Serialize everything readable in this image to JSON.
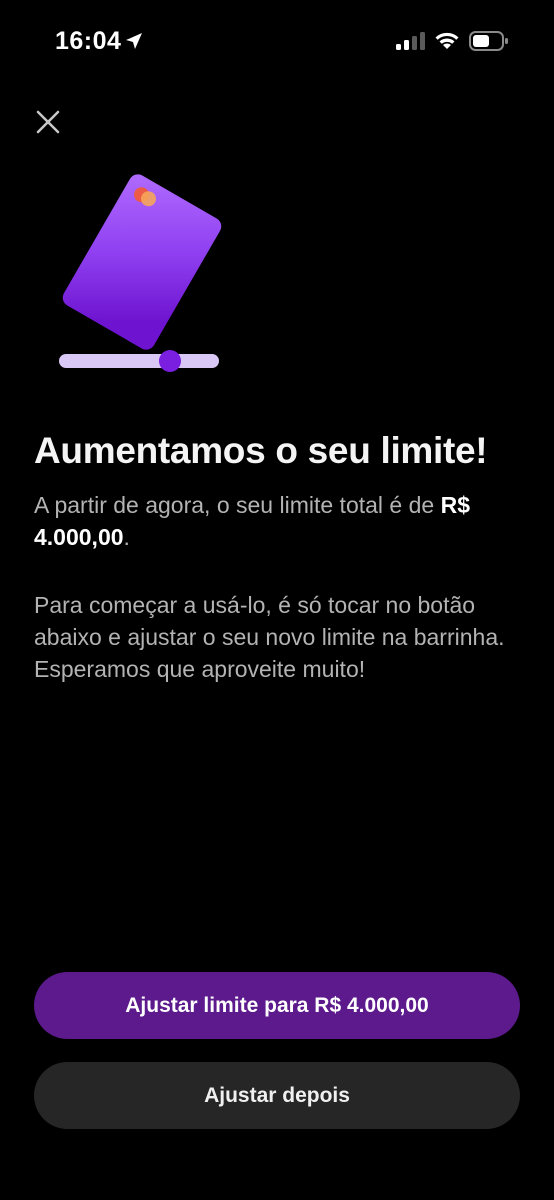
{
  "status_bar": {
    "time": "16:04",
    "icons": [
      "location-arrow-icon",
      "cellular-signal-icon",
      "wifi-icon",
      "battery-icon"
    ]
  },
  "header": {
    "close_icon": "close-icon"
  },
  "illustration": {
    "description_icons": [
      "credit-card-icon",
      "limit-slider-icon"
    ],
    "colors": {
      "card": "#8a2be2",
      "card_light": "#a95bff",
      "slider_track": "#d9c8f5",
      "slider_knob": "#7a1ee0",
      "logo_red": "#f05a3c",
      "logo_orange": "#f6a55a"
    },
    "slider_level": 0.7
  },
  "content": {
    "title": "Aumentamos o seu limite!",
    "paragraph1_prefix": "A partir de agora, o seu limite total é de ",
    "paragraph1_amount": "R$ 4.000,00",
    "paragraph1_suffix": ".",
    "paragraph2": "Para começar a usá-lo, é só tocar no botão abaixo e ajustar o seu novo limite na barrinha. Esperamos que aproveite muito!"
  },
  "actions": {
    "primary_label": "Ajustar limite para R$ 4.000,00",
    "secondary_label": "Ajustar depois"
  },
  "colors": {
    "background": "#000000",
    "primary_button": "#5d1a8c",
    "secondary_button": "#262626",
    "text_primary": "#f4f4f4",
    "text_secondary": "#b3b3b3"
  }
}
